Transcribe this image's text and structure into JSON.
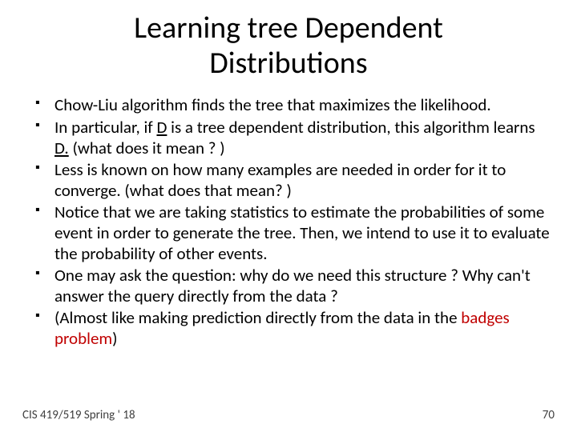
{
  "title": "Learning tree Dependent Distributions",
  "bullets": [
    {
      "pre": "Chow-Liu algorithm finds the tree that  maximizes the likelihood."
    },
    {
      "pre": "In particular, if ",
      "ul": "D",
      "mid": " is a tree dependent distribution, this algorithm learns ",
      "ul2": "D.",
      "post": "  (what does it mean ? )"
    },
    {
      "pre": "Less is known on how many examples are needed in order for it to converge.  (what does that mean? )"
    },
    {
      "pre": "Notice that we are taking statistics to estimate the probabilities of some event in order to generate the tree. Then, we intend to use it to evaluate the probability of other events."
    },
    {
      "pre": "One may ask the question: why do we need this structure ? Why can't  answer the query directly from the data ?"
    },
    {
      "pre": "(Almost like making prediction directly from the data in the ",
      "red": "badges problem",
      "post": ")"
    }
  ],
  "footer": {
    "left": "CIS 419/519 Spring ' 18",
    "right": "70"
  }
}
